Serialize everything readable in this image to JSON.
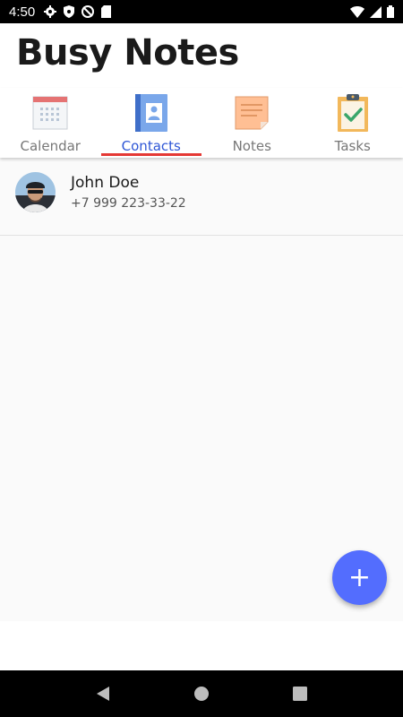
{
  "status_bar": {
    "time": "4:50",
    "left_icons": [
      "gear-icon",
      "shield-icon",
      "no-sync-icon",
      "sd-card-icon"
    ],
    "right_icons": [
      "wifi-icon",
      "signal-icon",
      "battery-icon"
    ]
  },
  "app": {
    "title": "Busy Notes"
  },
  "tabs": [
    {
      "label": "Calendar",
      "icon": "calendar-icon",
      "active": false
    },
    {
      "label": "Contacts",
      "icon": "contacts-book-icon",
      "active": true
    },
    {
      "label": "Notes",
      "icon": "note-icon",
      "active": false
    },
    {
      "label": "Tasks",
      "icon": "clipboard-check-icon",
      "active": false
    }
  ],
  "contacts": [
    {
      "name": "John Doe",
      "phone": "+7 999 223-33-22"
    }
  ],
  "fab": {
    "symbol": "+",
    "icon": "plus-icon"
  },
  "colors": {
    "accent": "#536dfe",
    "active_tab_text": "#2e56d6",
    "tab_indicator": "#e53935"
  },
  "nav": [
    "back-icon",
    "home-icon",
    "recents-icon"
  ]
}
